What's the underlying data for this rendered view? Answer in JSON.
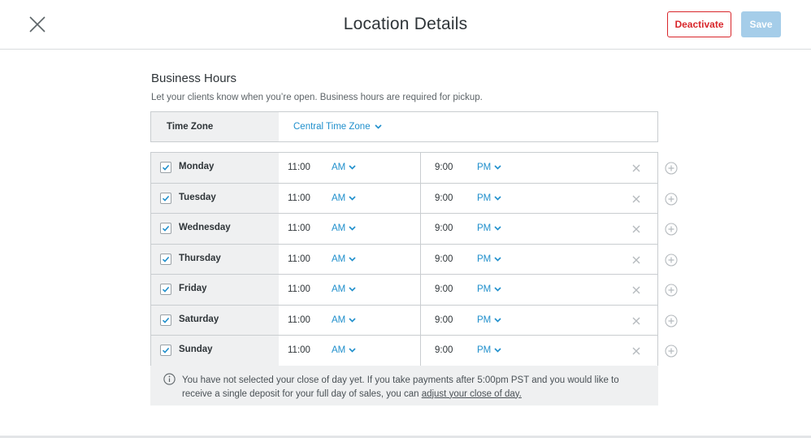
{
  "header": {
    "title": "Location Details",
    "deactivate_label": "Deactivate",
    "save_label": "Save"
  },
  "section": {
    "title": "Business Hours",
    "description": "Let your clients know when you’re open. Business hours are required for pickup."
  },
  "timezone": {
    "label": "Time Zone",
    "value": "Central Time Zone"
  },
  "days": [
    {
      "name": "Monday",
      "checked": true,
      "open_time": "11:00",
      "open_period": "AM",
      "close_time": "9:00",
      "close_period": "PM"
    },
    {
      "name": "Tuesday",
      "checked": true,
      "open_time": "11:00",
      "open_period": "AM",
      "close_time": "9:00",
      "close_period": "PM"
    },
    {
      "name": "Wednesday",
      "checked": true,
      "open_time": "11:00",
      "open_period": "AM",
      "close_time": "9:00",
      "close_period": "PM"
    },
    {
      "name": "Thursday",
      "checked": true,
      "open_time": "11:00",
      "open_period": "AM",
      "close_time": "9:00",
      "close_period": "PM"
    },
    {
      "name": "Friday",
      "checked": true,
      "open_time": "11:00",
      "open_period": "AM",
      "close_time": "9:00",
      "close_period": "PM"
    },
    {
      "name": "Saturday",
      "checked": true,
      "open_time": "11:00",
      "open_period": "AM",
      "close_time": "9:00",
      "close_period": "PM"
    },
    {
      "name": "Sunday",
      "checked": true,
      "open_time": "11:00",
      "open_period": "AM",
      "close_time": "9:00",
      "close_period": "PM"
    }
  ],
  "notice": {
    "text": "You have not selected your close of day yet. If you take payments after 5:00pm PST and you would like to receive a single deposit for your full day of sales, you can ",
    "link": "adjust your close of day."
  },
  "icons": {
    "close": "close-icon",
    "chevron": "chevron-down-icon",
    "check": "checkmark-icon",
    "remove": "remove-x-icon",
    "add": "add-circle-icon",
    "info": "info-icon"
  },
  "colors": {
    "accent": "#1f8fcc",
    "danger": "#d8262b",
    "save_disabled": "#a5cde9",
    "panel": "#eff0f1"
  }
}
